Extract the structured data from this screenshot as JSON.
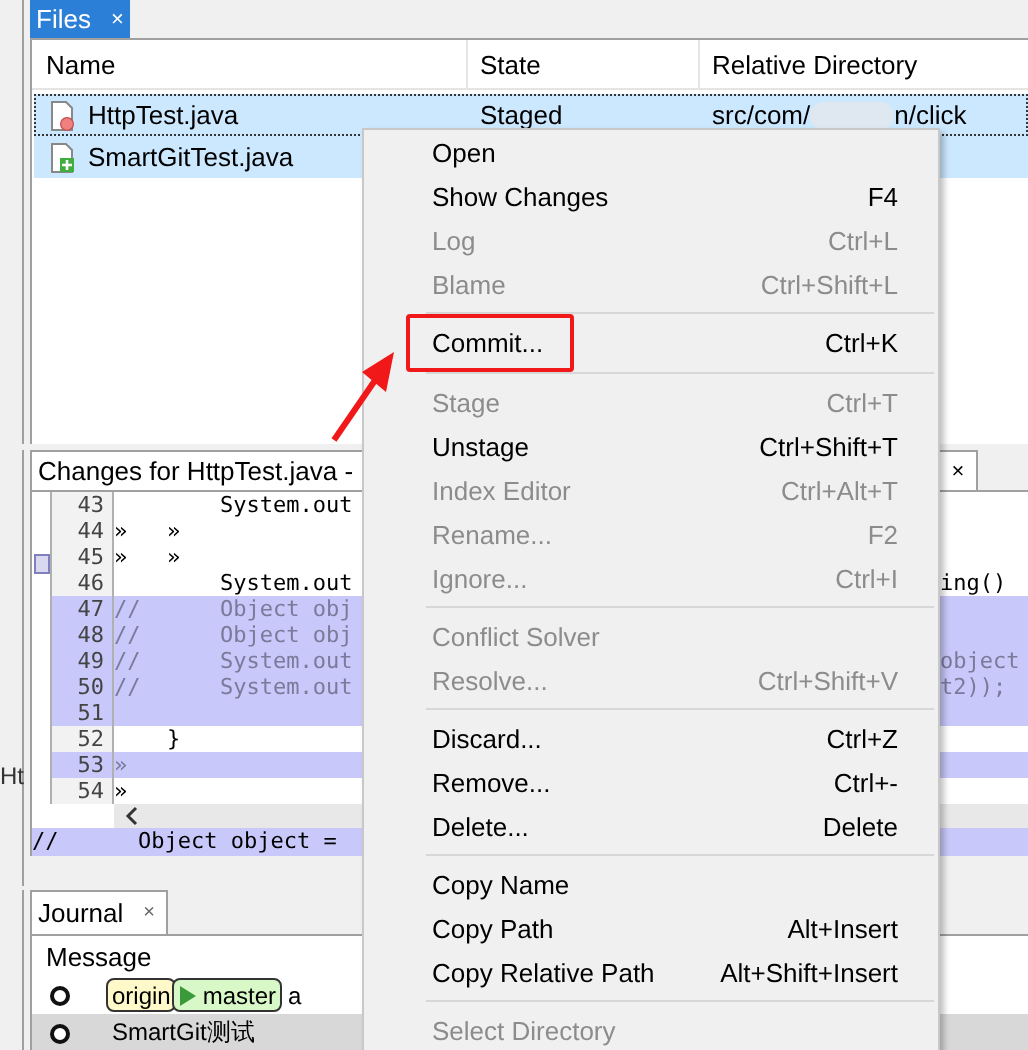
{
  "files_panel": {
    "tab": {
      "label": "Files",
      "close": "×",
      "selected": true
    },
    "columns": [
      "Name",
      "State",
      "Relative Directory"
    ],
    "rows": [
      {
        "name": "HttpTest.java",
        "kind": "modified",
        "state": "Staged",
        "directory_start": "src/com/",
        "directory_end": "n/click",
        "selected": true,
        "focused": true
      },
      {
        "name": "SmartGitTest.java",
        "kind": "added",
        "selected": true,
        "focused": false
      }
    ]
  },
  "side_strip": {
    "label": "Ht"
  },
  "changes_panel": {
    "tab": {
      "label": "Changes for HttpTest.java -",
      "close": "×"
    },
    "lines": [
      {
        "number": "43",
        "text": "        System.out",
        "kind": "plain"
      },
      {
        "number": "44",
        "text": "»   »",
        "kind": "plain"
      },
      {
        "number": "45",
        "text": "»   »",
        "kind": "plain"
      },
      {
        "number": "46",
        "text": "        System.out",
        "right": "ing()",
        "kind": "plain"
      },
      {
        "number": "47",
        "text": "//      Object obj",
        "kind": "changed"
      },
      {
        "number": "48",
        "text": "//      Object obj",
        "kind": "changed"
      },
      {
        "number": "49",
        "text": "//      System.out",
        "right": "object",
        "kind": "changed"
      },
      {
        "number": "50",
        "text": "//      System.out",
        "right": "t2));",
        "kind": "changed"
      },
      {
        "number": "51",
        "kind": "changed"
      },
      {
        "number": "52",
        "text": "    }",
        "kind": "plain"
      },
      {
        "number": "53",
        "text": "»",
        "kind": "changed"
      },
      {
        "number": "54",
        "text": "»",
        "kind": "plain"
      }
    ],
    "bottom_line": "//      Object object ="
  },
  "journal": {
    "tab": {
      "label": "Journal",
      "close": "×"
    },
    "header": "Message",
    "rows": [
      {
        "refs": [
          {
            "label": "origin",
            "kind": "remote"
          },
          {
            "label": "master",
            "kind": "local"
          }
        ],
        "message": "a",
        "selected": false
      },
      {
        "message": "SmartGit测试",
        "selected": true
      }
    ]
  },
  "context_menu": {
    "items": [
      {
        "kind": "item",
        "label": "Open",
        "disabled": false
      },
      {
        "kind": "item",
        "label": "Show Changes",
        "shortcut": "F4",
        "disabled": false
      },
      {
        "kind": "item",
        "label": "Log",
        "shortcut": "Ctrl+L",
        "disabled": true
      },
      {
        "kind": "item",
        "label": "Blame",
        "shortcut": "Ctrl+Shift+L",
        "disabled": true
      },
      {
        "kind": "separator"
      },
      {
        "kind": "item",
        "label": "Commit...",
        "shortcut": "Ctrl+K",
        "disabled": false,
        "annotated": true
      },
      {
        "kind": "separator"
      },
      {
        "kind": "item",
        "label": "Stage",
        "shortcut": "Ctrl+T",
        "disabled": true
      },
      {
        "kind": "item",
        "label": "Unstage",
        "shortcut": "Ctrl+Shift+T",
        "disabled": false
      },
      {
        "kind": "item",
        "label": "Index Editor",
        "shortcut": "Ctrl+Alt+T",
        "disabled": true
      },
      {
        "kind": "item",
        "label": "Rename...",
        "shortcut": "F2",
        "disabled": true
      },
      {
        "kind": "item",
        "label": "Ignore...",
        "shortcut": "Ctrl+I",
        "disabled": true
      },
      {
        "kind": "separator"
      },
      {
        "kind": "item",
        "label": "Conflict Solver",
        "disabled": true
      },
      {
        "kind": "item",
        "label": "Resolve...",
        "shortcut": "Ctrl+Shift+V",
        "disabled": true
      },
      {
        "kind": "separator"
      },
      {
        "kind": "item",
        "label": "Discard...",
        "shortcut": "Ctrl+Z",
        "disabled": false
      },
      {
        "kind": "item",
        "label": "Remove...",
        "shortcut": "Ctrl+-",
        "disabled": false
      },
      {
        "kind": "item",
        "label": "Delete...",
        "shortcut": "Delete",
        "disabled": false
      },
      {
        "kind": "separator"
      },
      {
        "kind": "item",
        "label": "Copy Name",
        "disabled": false
      },
      {
        "kind": "item",
        "label": "Copy Path",
        "shortcut": "Alt+Insert",
        "disabled": false
      },
      {
        "kind": "item",
        "label": "Copy Relative Path",
        "shortcut": "Alt+Shift+Insert",
        "disabled": false
      },
      {
        "kind": "separator"
      },
      {
        "kind": "item",
        "label": "Select Directory",
        "disabled": true
      }
    ]
  }
}
